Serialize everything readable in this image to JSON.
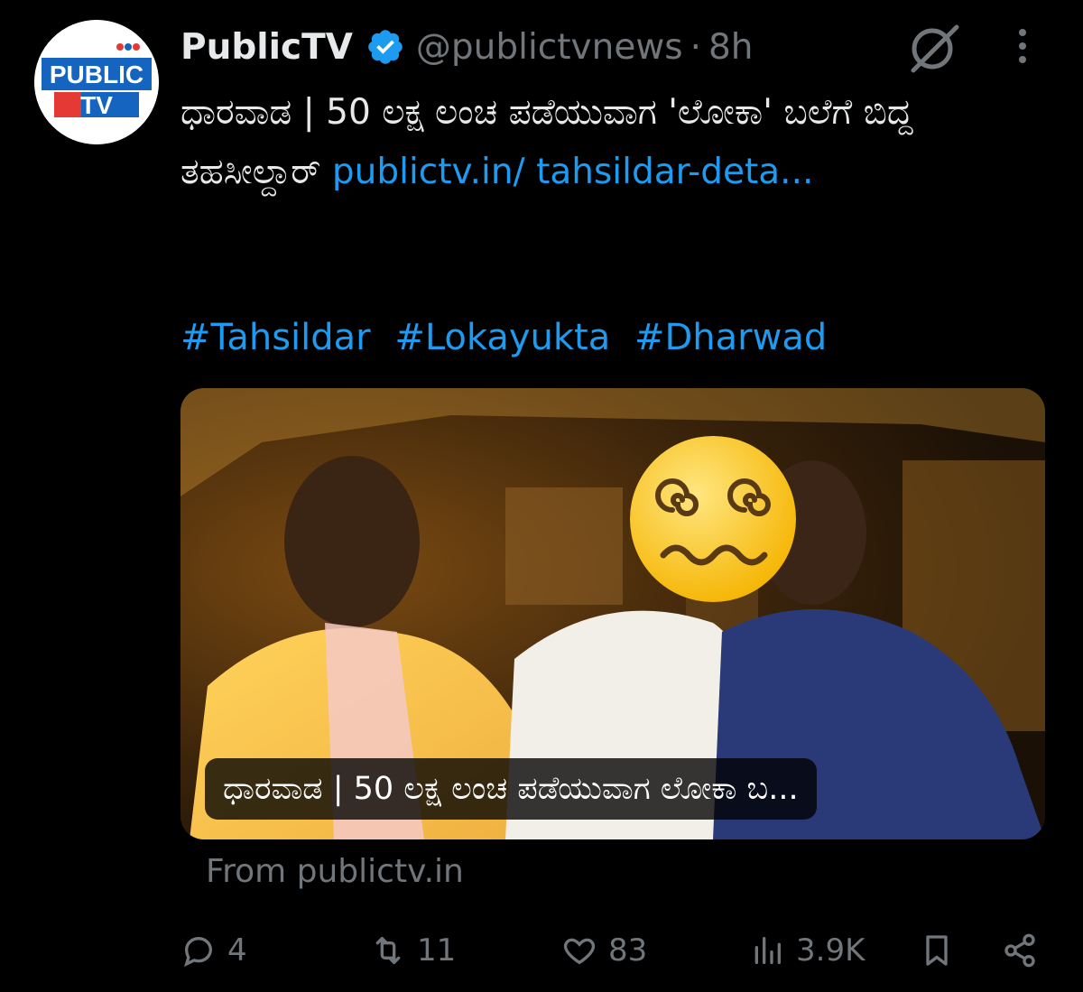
{
  "tweet": {
    "avatar_icon": "publictv-logo",
    "avatar_logo_text": [
      "PUBLIC",
      "TV"
    ],
    "author_name": "PublicTV",
    "verified_icon": "verified-badge-icon",
    "handle": "@publictvnews",
    "separator": "·",
    "time": "8h",
    "text_kannada": "ಧಾರವಾಡ | 50 ಲಕ್ಷ ಲಂಚ ಪಡೆಯುವಾಗ 'ಲೋಕಾ' ಬಲೆಗೆ ಬಿದ್ದ ತಹಸೀಲ್ದಾರ್",
    "link_text": "publictv.in/ tahsildar-deta...",
    "hashtags": [
      "#Tahsildar",
      "#Lokayukta",
      "#Dharwad"
    ]
  },
  "card": {
    "image_subject": "night photo of three men in a vehicle, one face covered by dizzy emoji",
    "emoji_icon": "dizzy-face-emoji",
    "caption": "ಧಾರವಾಡ | 50 ಲಕ್ಷ ಲಂಚ ಪಡೆಯುವಾಗ ಲೋಕಾ ಬ...",
    "source": "From publictv.in"
  },
  "actions": {
    "reply": {
      "icon": "reply-icon",
      "count": "4"
    },
    "retweet": {
      "icon": "retweet-icon",
      "count": "11"
    },
    "like": {
      "icon": "heart-icon",
      "count": "83"
    },
    "views": {
      "icon": "views-chart-icon",
      "count": "3.9K"
    },
    "bookmark": {
      "icon": "bookmark-icon"
    },
    "share": {
      "icon": "share-icon"
    }
  },
  "colors": {
    "background": "#000000",
    "text": "#e7e9ea",
    "muted": "#71767b",
    "link": "#1d9bf0",
    "verified": "#1d9bf0",
    "logo_blue": "#1565c0",
    "logo_red": "#e53935"
  }
}
